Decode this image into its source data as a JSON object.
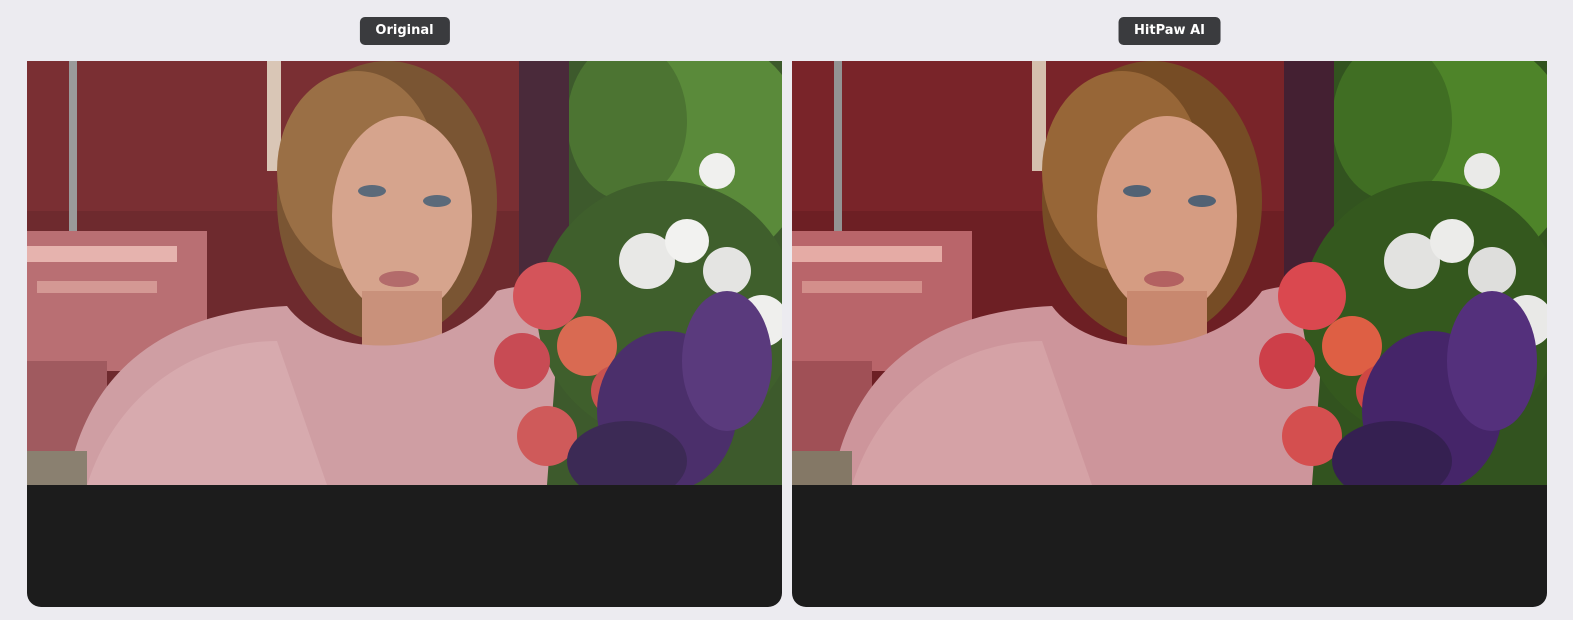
{
  "panels": [
    {
      "label": "Original",
      "image": "portrait-video-frame-original"
    },
    {
      "label": "HitPaw AI",
      "image": "portrait-video-frame-enhanced"
    }
  ],
  "colors": {
    "background": "#ecebf0",
    "label_bg": "#3a3b3e",
    "label_text": "#ffffff",
    "frame_bg": "#1c1c1c"
  }
}
